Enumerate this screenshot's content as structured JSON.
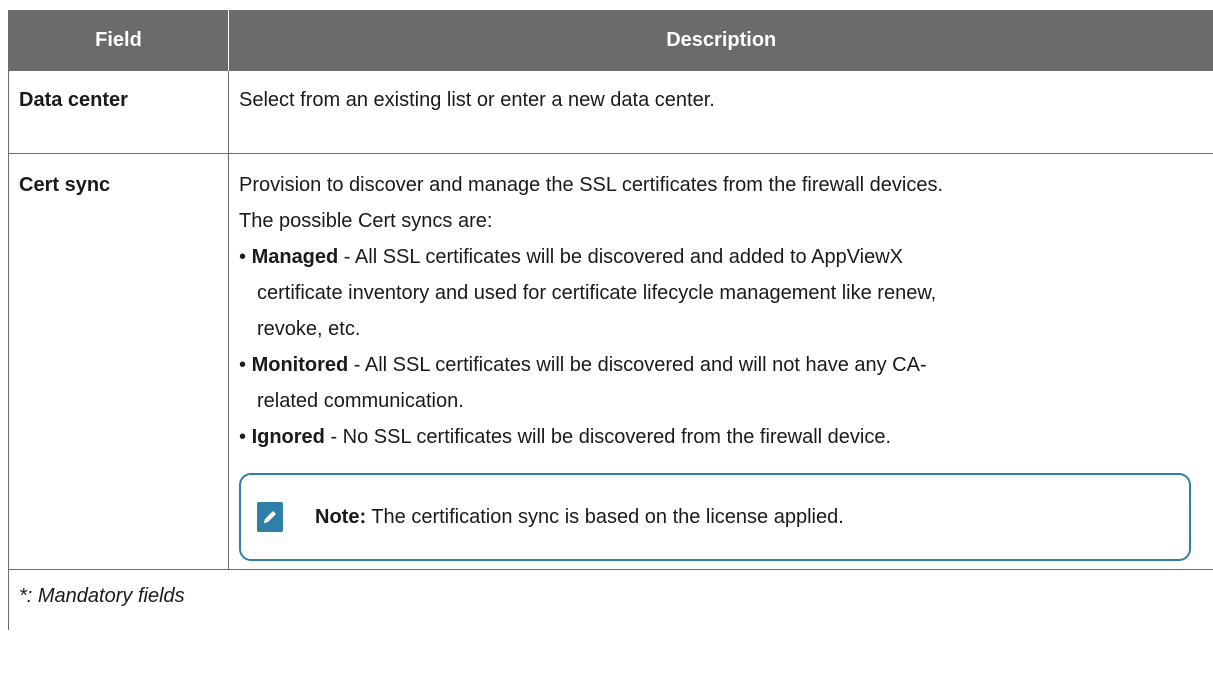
{
  "table": {
    "headers": {
      "field": "Field",
      "description": "Description"
    },
    "rows": [
      {
        "field": "Data center",
        "description": "Select from an existing list or enter a new data center."
      },
      {
        "field": "Cert sync",
        "intro": "Provision to discover and manage the SSL certificates from the firewall devices.",
        "intro2": "The possible Cert syncs are:",
        "bullets": [
          {
            "term": "Managed",
            "line1": " - All SSL certificates will be discovered and added to AppViewX",
            "line2": "certificate inventory and used for certificate lifecycle management like renew,",
            "line3": "revoke, etc."
          },
          {
            "term": "Monitored",
            "line1": " - All SSL certificates will be discovered and will not have any CA-",
            "line2": "related communication."
          },
          {
            "term": "Ignored",
            "line1": " - No SSL certificates will be discovered from the firewall device."
          }
        ],
        "note": {
          "label": "Note:",
          "text": " The certification sync is based on the license applied.",
          "icon": "pencil-note-icon",
          "border_color": "#2f7fa8"
        }
      }
    ],
    "footer": "*: Mandatory fields"
  },
  "colors": {
    "header_bg": "#6b6b6b",
    "header_text": "#ffffff",
    "accent": "#2f7fa8"
  }
}
